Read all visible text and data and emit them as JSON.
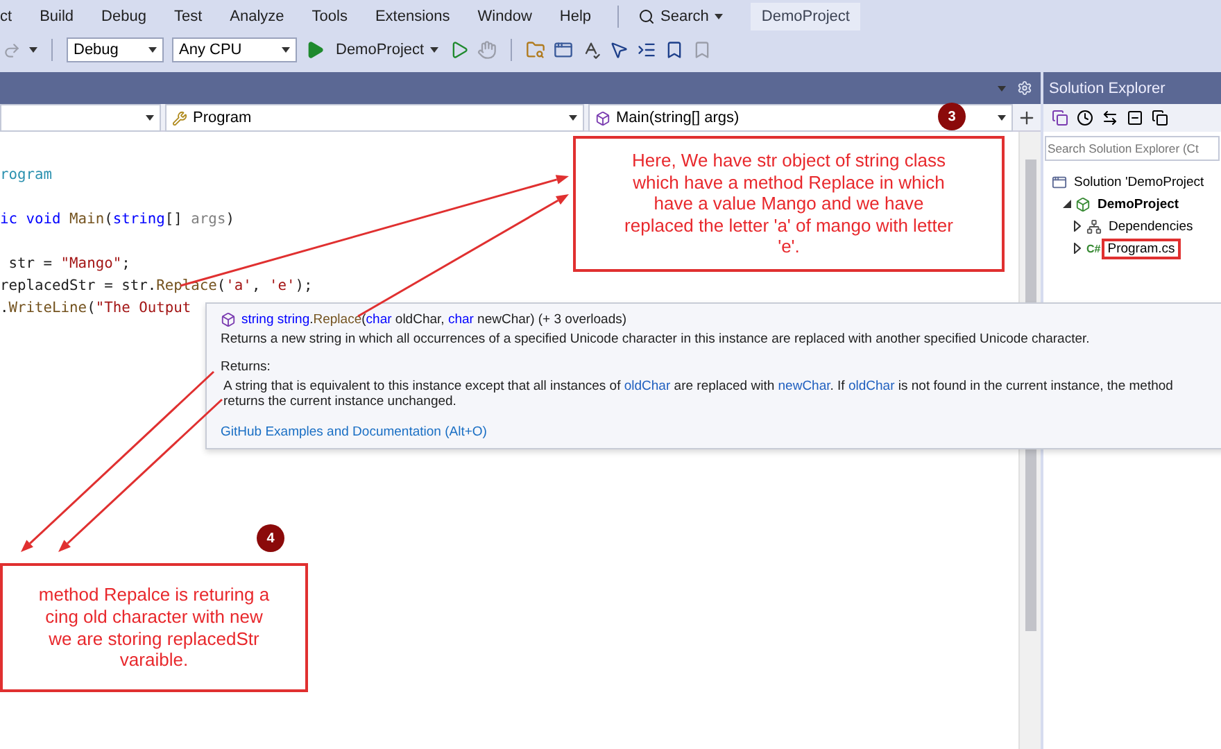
{
  "menu": [
    "ct",
    "Build",
    "Debug",
    "Test",
    "Analyze",
    "Tools",
    "Extensions",
    "Window",
    "Help"
  ],
  "search": {
    "label": "Search"
  },
  "title_badge": "DemoProject",
  "toolbar": {
    "configuration": "Debug",
    "platform": "Any CPU",
    "start_target": "DemoProject"
  },
  "navigation": {
    "type": "Program",
    "member": "Main(string[] args)"
  },
  "code": [
    {
      "segments": [
        {
          "text": "rogram",
          "kind": "type"
        }
      ]
    },
    {
      "segments": [
        {
          "text": "ic void ",
          "kind": "keyword"
        },
        {
          "text": "Main",
          "kind": "method"
        },
        {
          "text": "(",
          "kind": "plain"
        },
        {
          "text": "string",
          "kind": "keyword"
        },
        {
          "text": "[] ",
          "kind": "plain"
        },
        {
          "text": "args",
          "kind": "param"
        },
        {
          "text": ")",
          "kind": "plain"
        }
      ]
    },
    {
      "segments": [
        {
          "text": " str = ",
          "kind": "plain"
        },
        {
          "text": "\"Mango\"",
          "kind": "string"
        },
        {
          "text": ";",
          "kind": "plain"
        }
      ]
    },
    {
      "segments": [
        {
          "text": "replacedStr = str.",
          "kind": "plain"
        },
        {
          "text": "Replace",
          "kind": "method"
        },
        {
          "text": "(",
          "kind": "plain"
        },
        {
          "text": "'a'",
          "kind": "string"
        },
        {
          "text": ", ",
          "kind": "plain"
        },
        {
          "text": "'e'",
          "kind": "string"
        },
        {
          "text": ");",
          "kind": "plain"
        }
      ]
    },
    {
      "segments": [
        {
          "text": ".",
          "kind": "plain"
        },
        {
          "text": "WriteLine",
          "kind": "method"
        },
        {
          "text": "(",
          "kind": "plain"
        },
        {
          "text": "\"The Output",
          "kind": "string"
        }
      ]
    }
  ],
  "tooltip": {
    "signature": [
      {
        "text": "string",
        "kind": "keyword"
      },
      {
        "text": " string",
        "kind": "keyword"
      },
      {
        "text": ".",
        "kind": "plain"
      },
      {
        "text": "Replace",
        "kind": "method"
      },
      {
        "text": "(",
        "kind": "plain"
      },
      {
        "text": "char",
        "kind": "keyword"
      },
      {
        "text": " oldChar, ",
        "kind": "plain"
      },
      {
        "text": "char",
        "kind": "keyword"
      },
      {
        "text": " newChar) (+ 3 overloads)",
        "kind": "plain"
      }
    ],
    "description": "Returns a new string in which all occurrences of a specified Unicode character in this instance are replaced with another specified Unicode character.",
    "returns_label": "Returns:",
    "returns": [
      {
        "text": "A string that is equivalent to this instance except that all instances of ",
        "kind": "plain"
      },
      {
        "text": "oldChar",
        "kind": "param"
      },
      {
        "text": " are replaced with ",
        "kind": "plain"
      },
      {
        "text": "newChar",
        "kind": "param"
      },
      {
        "text": ". If ",
        "kind": "plain"
      },
      {
        "text": "oldChar",
        "kind": "param"
      },
      {
        "text": " is not found in the current instance, the method returns the current instance unchanged.",
        "kind": "plain"
      }
    ],
    "link": "GitHub Examples and Documentation (Alt+O)"
  },
  "solution_explorer": {
    "title": "Solution Explorer",
    "search_placeholder": "Search Solution Explorer (Ct",
    "tree": [
      {
        "label": "Solution 'DemoProject",
        "kind": "solution",
        "highlighted": false,
        "children": [
          {
            "label": "DemoProject",
            "kind": "project",
            "expanded": true,
            "highlighted": false,
            "children": [
              {
                "label": "Dependencies",
                "kind": "dependencies",
                "expanded": false,
                "highlighted": false
              },
              {
                "label": "Program.cs",
                "kind": "file",
                "badge": "C#",
                "expanded": false,
                "highlighted": true
              }
            ]
          }
        ]
      }
    ]
  },
  "annotations": [
    {
      "number": "3",
      "lines": [
        "Here, We have str object of string class",
        "which have a method Replace in which",
        "have a value Mango and we have",
        "replaced the letter 'a' of mango with letter",
        "'e'."
      ]
    },
    {
      "number": "4",
      "lines": [
        "method Repalce is returing a",
        "cing old character with new",
        "we are storing replacedStr",
        "varaible."
      ]
    }
  ]
}
